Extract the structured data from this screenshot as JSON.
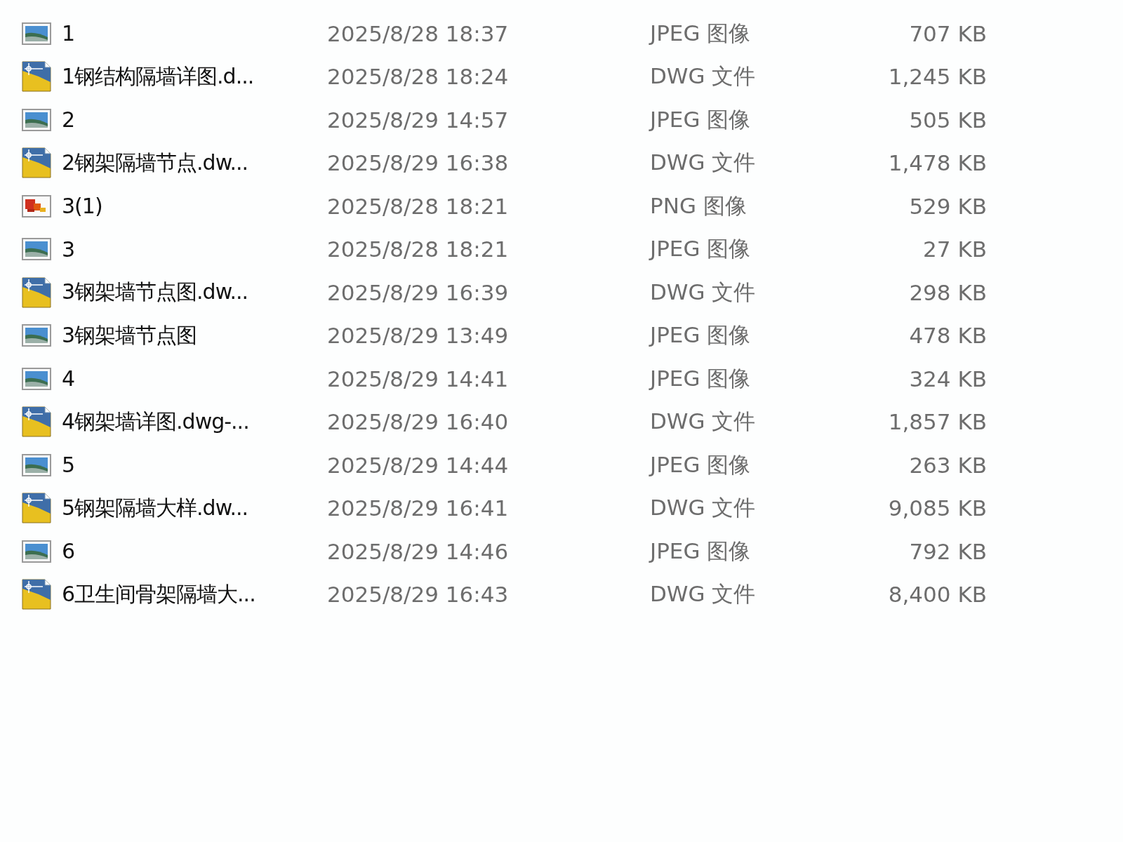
{
  "files": [
    {
      "kind": "jpeg",
      "name": "1",
      "modified": "2025/8/28 18:37",
      "type": "JPEG 图像",
      "size": "707 KB"
    },
    {
      "kind": "dwg",
      "name": "1钢结构隔墙详图.d...",
      "modified": "2025/8/28 18:24",
      "type": "DWG 文件",
      "size": "1,245 KB"
    },
    {
      "kind": "jpeg",
      "name": "2",
      "modified": "2025/8/29 14:57",
      "type": "JPEG 图像",
      "size": "505 KB"
    },
    {
      "kind": "dwg",
      "name": "2钢架隔墙节点.dw...",
      "modified": "2025/8/29 16:38",
      "type": "DWG 文件",
      "size": "1,478 KB"
    },
    {
      "kind": "png",
      "name": "3(1)",
      "modified": "2025/8/28 18:21",
      "type": "PNG 图像",
      "size": "529 KB"
    },
    {
      "kind": "jpeg",
      "name": "3",
      "modified": "2025/8/28 18:21",
      "type": "JPEG 图像",
      "size": "27 KB"
    },
    {
      "kind": "dwg",
      "name": "3钢架墙节点图.dw...",
      "modified": "2025/8/29 16:39",
      "type": "DWG 文件",
      "size": "298 KB"
    },
    {
      "kind": "jpeg",
      "name": "3钢架墙节点图",
      "modified": "2025/8/29 13:49",
      "type": "JPEG 图像",
      "size": "478 KB"
    },
    {
      "kind": "jpeg",
      "name": "4",
      "modified": "2025/8/29 14:41",
      "type": "JPEG 图像",
      "size": "324 KB"
    },
    {
      "kind": "dwg",
      "name": "4钢架墙详图.dwg-...",
      "modified": "2025/8/29 16:40",
      "type": "DWG 文件",
      "size": "1,857 KB"
    },
    {
      "kind": "jpeg",
      "name": "5",
      "modified": "2025/8/29 14:44",
      "type": "JPEG 图像",
      "size": "263 KB"
    },
    {
      "kind": "dwg",
      "name": "5钢架隔墙大样.dw...",
      "modified": "2025/8/29 16:41",
      "type": "DWG 文件",
      "size": "9,085 KB"
    },
    {
      "kind": "jpeg",
      "name": "6",
      "modified": "2025/8/29 14:46",
      "type": "JPEG 图像",
      "size": "792 KB"
    },
    {
      "kind": "dwg",
      "name": "6卫生间骨架隔墙大...",
      "modified": "2025/8/29 16:43",
      "type": "DWG 文件",
      "size": "8,400 KB"
    }
  ]
}
